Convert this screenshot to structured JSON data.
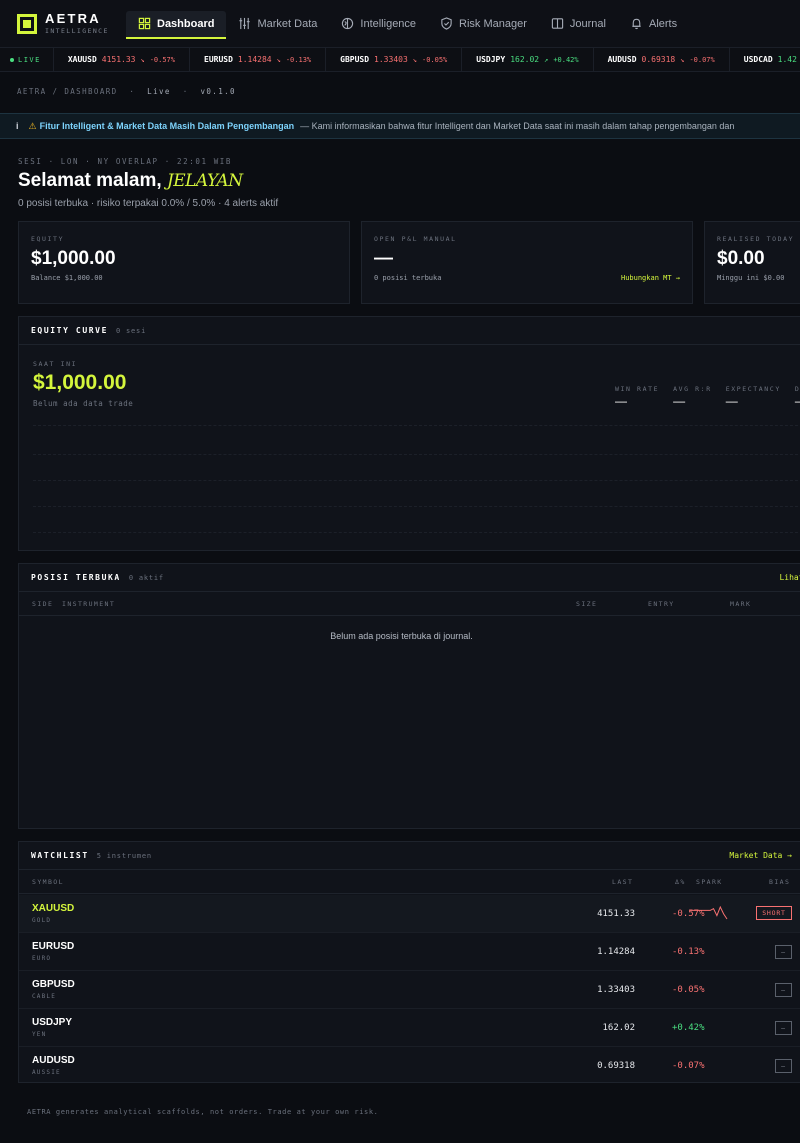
{
  "brand": {
    "name": "AETRA",
    "sub": "INTELLIGENCE"
  },
  "nav": [
    {
      "label": "Dashboard",
      "icon": "grid-icon",
      "active": true
    },
    {
      "label": "Market Data",
      "icon": "sliders-icon"
    },
    {
      "label": "Intelligence",
      "icon": "brain-icon"
    },
    {
      "label": "Risk Manager",
      "icon": "shield-icon"
    },
    {
      "label": "Journal",
      "icon": "book-icon"
    },
    {
      "label": "Alerts",
      "icon": "bell-icon"
    }
  ],
  "ticker": {
    "live_label": "LIVE",
    "items": [
      {
        "symbol": "XAUUSD",
        "price": "4151.33",
        "change": "-0.57%",
        "dir": "down"
      },
      {
        "symbol": "EURUSD",
        "price": "1.14284",
        "change": "-0.13%",
        "dir": "down"
      },
      {
        "symbol": "GBPUSD",
        "price": "1.33403",
        "change": "-0.05%",
        "dir": "down"
      },
      {
        "symbol": "USDJPY",
        "price": "162.02",
        "change": "+0.42%",
        "dir": "up"
      },
      {
        "symbol": "AUDUSD",
        "price": "0.69318",
        "change": "-0.07%",
        "dir": "down"
      },
      {
        "symbol": "USDCAD",
        "price": "1.42",
        "change": "",
        "dir": "up"
      }
    ]
  },
  "breadcrumb": {
    "path": "AETRA / DASHBOARD",
    "sep": "·",
    "mode": "Live",
    "version": "v0.1.0"
  },
  "banner": {
    "info": "i",
    "warn": "⚠",
    "title": "Fitur Intelligent & Market Data Masih Dalam Pengembangan",
    "message": "— Kami informasikan bahwa fitur Intelligent dan Market Data saat ini masih dalam tahap pengembangan dan"
  },
  "header": {
    "session": "SESI · LON · NY OVERLAP · 22:01 WIB",
    "greeting": "Selamat malam,",
    "username": "JELAYAN",
    "subline": "0 posisi terbuka · risiko terpakai 0.0% / 5.0% · 4 alerts aktif"
  },
  "stats": {
    "equity": {
      "caption": "EQUITY",
      "value": "$1,000.00",
      "sub": "Balance $1,000.00"
    },
    "open_pnl": {
      "caption": "OPEN P&L MANUAL",
      "value": "—",
      "sub": "0 posisi terbuka",
      "link": "Hubungkan MT →"
    },
    "realised": {
      "caption": "REALISED TODAY",
      "value": "$0.00",
      "sub": "Minggu ini $0.00"
    }
  },
  "equity_curve": {
    "title": "EQUITY CURVE",
    "count": "0 sesi",
    "now_caption": "SAAT INI",
    "now_value": "$1,000.00",
    "note": "Belum ada data trade",
    "metrics": [
      {
        "label": "WIN RATE",
        "value": "—"
      },
      {
        "label": "AVG R:R",
        "value": "—"
      },
      {
        "label": "EXPECTANCY",
        "value": "—"
      },
      {
        "label": "DR",
        "value": "—"
      }
    ]
  },
  "positions": {
    "title": "POSISI TERBUKA",
    "count": "0 aktif",
    "link": "Lihat jo",
    "columns": {
      "side": "SIDE",
      "instrument": "INSTRUMENT",
      "size": "SIZE",
      "entry": "ENTRY",
      "mark": "MARK"
    },
    "empty": "Belum ada posisi terbuka di journal."
  },
  "watchlist": {
    "title": "WATCHLIST",
    "count": "5 instrumen",
    "link": "Market Data →",
    "columns": {
      "symbol": "SYMBOL",
      "last": "LAST",
      "change": "Δ%",
      "spark": "SPARK",
      "bias": "BIAS"
    },
    "rows": [
      {
        "symbol": "XAUUSD",
        "name": "GOLD",
        "last": "4151.33",
        "change": "-0.57%",
        "dir": "down",
        "bias": "SHORT",
        "spark": [
          3,
          3,
          3,
          3,
          3,
          3,
          3,
          2,
          6,
          1,
          5,
          8
        ]
      },
      {
        "symbol": "EURUSD",
        "name": "EURO",
        "last": "1.14284",
        "change": "-0.13%",
        "dir": "down",
        "bias": "–"
      },
      {
        "symbol": "GBPUSD",
        "name": "CABLE",
        "last": "1.33403",
        "change": "-0.05%",
        "dir": "down",
        "bias": "–"
      },
      {
        "symbol": "USDJPY",
        "name": "YEN",
        "last": "162.02",
        "change": "+0.42%",
        "dir": "up",
        "bias": "–"
      },
      {
        "symbol": "AUDUSD",
        "name": "AUSSIE",
        "last": "0.69318",
        "change": "-0.07%",
        "dir": "down",
        "bias": "–"
      }
    ]
  },
  "footer": "AETRA generates analytical scaffolds, not orders. Trade at your own risk.",
  "colors": {
    "accent": "#d4f53c",
    "negative": "#f87171",
    "positive": "#4ade80",
    "info": "#7dd3fc"
  }
}
